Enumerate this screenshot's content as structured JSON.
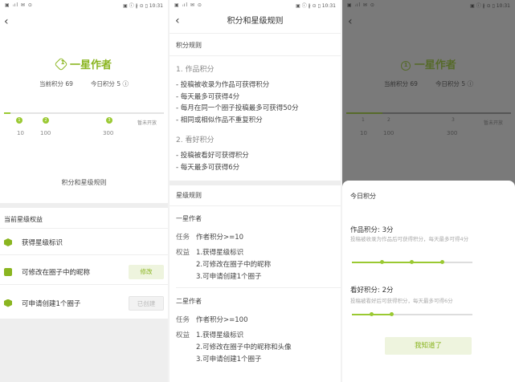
{
  "status": {
    "left": "▣ ᵢıl ✉ ⊙",
    "right": "▣ ⓘ ∦ ⊙ ▯ 10:31"
  },
  "screen1": {
    "level_badge": "1",
    "level_title": "一星作者",
    "current_points": "当前积分 69",
    "today_points": "今日积分 5 ⓘ",
    "progress": {
      "value": 69,
      "max": 300,
      "nodes": [
        "1",
        "2",
        "3"
      ],
      "ticks": [
        "10",
        "100",
        "300"
      ],
      "end_label": "暂未开放"
    },
    "rules_link": "积分和星级规则",
    "benefits_title": "当前星级权益",
    "benefits": [
      {
        "label": "获得星级标识",
        "button": ""
      },
      {
        "label": "可修改在圈子中的昵称",
        "button": "修改"
      },
      {
        "label": "可申请创建1个圈子",
        "button": "已创建"
      }
    ]
  },
  "screen2": {
    "title": "积分和星级规则",
    "points_rules": "积分规则",
    "s1_title": "1. 作品积分",
    "s1_lines": [
      "- 投稿被收录为作品可获得积分",
      "- 每天最多可获得4分",
      "- 每月在同一个圈子投稿最多可获得50分",
      "- 相同或相似作品不重复积分"
    ],
    "s2_title": "2. 看好积分",
    "s2_lines": [
      "- 投稿被看好可获得积分",
      "- 每天最多可获得6分"
    ],
    "star_rules": "星级规则",
    "levels": [
      {
        "name": "一星作者",
        "task_label": "任务",
        "task": "作者积分>=10",
        "benefit_label": "权益",
        "benefits": [
          "1.获得星级标识",
          "2.可修改在圈子中的昵称",
          "3.可申请创建1个圈子"
        ]
      },
      {
        "name": "二星作者",
        "task_label": "任务",
        "task": "作者积分>=100",
        "benefit_label": "权益",
        "benefits": [
          "1.获得星级标识",
          "2.可修改在圈子中的昵称和头像",
          "3.可申请创建1个圈子"
        ]
      }
    ]
  },
  "screen3": {
    "sheet_title": "今日积分",
    "works_label": "作品积分: 3分",
    "works_desc": "投稿被收录为作品后可获得积分，每天最多可得4分",
    "works_progress": 3,
    "works_max": 4,
    "good_label": "看好积分: 2分",
    "good_desc": "投稿被看好后可获得积分，每天最多可得6分",
    "good_progress": 2,
    "good_max": 6,
    "ok_button": "我知道了"
  }
}
